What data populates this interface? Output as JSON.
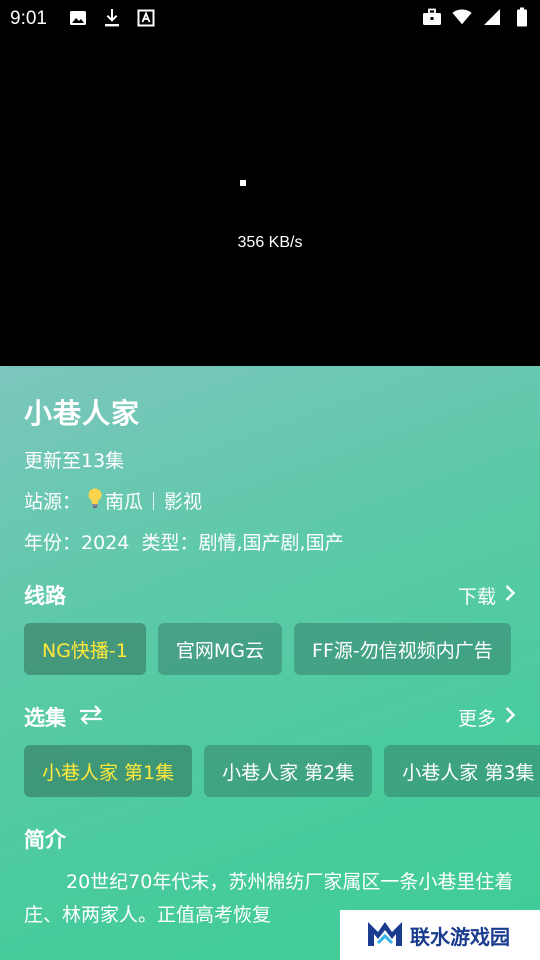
{
  "status_bar": {
    "time": "9:01",
    "left_icons": [
      "image-icon",
      "download-icon",
      "text-a-icon"
    ],
    "right_icons": [
      "briefcase-icon",
      "wifi-icon",
      "signal-icon",
      "battery-icon"
    ]
  },
  "player": {
    "net_speed": "356 KB/s"
  },
  "details": {
    "title": "小巷人家",
    "update_status": "更新至13集",
    "source_label": "站源：",
    "source_name": "南瓜",
    "source_category": "影视",
    "year_label": "年份：",
    "year": "2024",
    "type_label": "类型：",
    "type": "剧情,国产剧,国产"
  },
  "routes": {
    "title": "线路",
    "download_label": "下载",
    "items": [
      {
        "label": "NG快播-1",
        "active": true
      },
      {
        "label": "官网MG云",
        "active": false
      },
      {
        "label": "FF源-勿信视频内广告",
        "active": false
      }
    ]
  },
  "episodes": {
    "title": "选集",
    "more_label": "更多",
    "items": [
      {
        "label": "小巷人家 第1集",
        "active": true
      },
      {
        "label": "小巷人家 第2集",
        "active": false
      },
      {
        "label": "小巷人家 第3集",
        "active": false
      }
    ]
  },
  "intro": {
    "title": "简介",
    "text": "20世纪70年代末，苏州棉纺厂家属区一条小巷里住着庄、林两家人。正值高考恢复"
  },
  "watermark": {
    "text": "联水游戏园"
  },
  "colors": {
    "active_chip_text": "#ffe83a",
    "panel_gradient_start": "#7cc6bd",
    "panel_gradient_end": "#3dcc96"
  }
}
